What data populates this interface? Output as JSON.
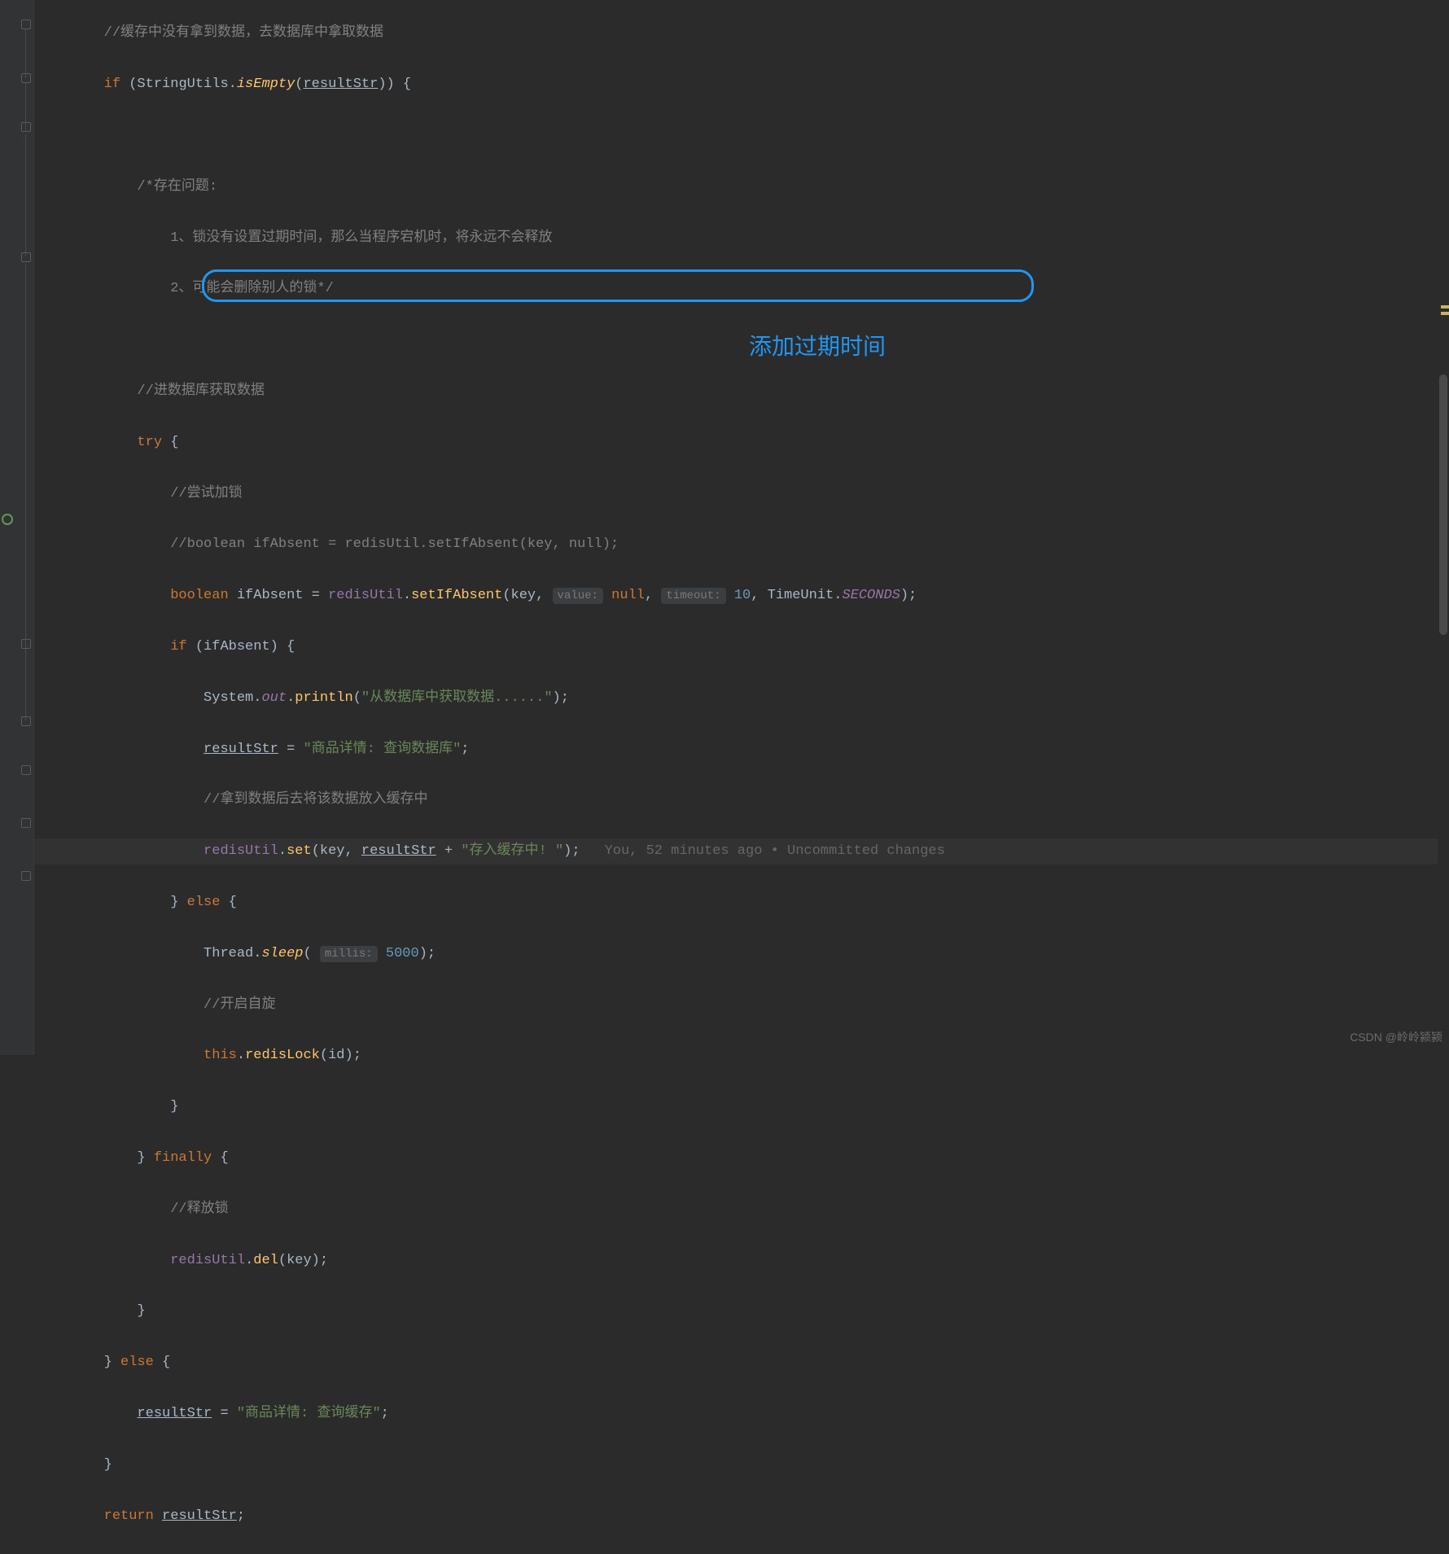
{
  "code": {
    "line1": "//缓存中没有拿到数据，去数据库中拿取数据",
    "line2_if": "if",
    "line2_a": " (StringUtils.",
    "line2_b": "isEmpty",
    "line2_c": "(",
    "line2_d": "resultStr",
    "line2_e": ")) {",
    "line3": "",
    "line4": "/*存在问题:",
    "line5": "    1、锁没有设置过期时间，那么当程序宕机时，将永远不会释放",
    "line6": "    2、可能会删除别人的锁*/",
    "line7": "",
    "line8": "//进数据库获取数据",
    "line9_try": "try",
    "line9_b": " {",
    "line10": "//尝试加锁",
    "line11": "//boolean ifAbsent = redisUtil.setIfAbsent(key, null);",
    "line12_a": "boolean",
    "line12_b": " ifAbsent = ",
    "line12_c": "redisUtil",
    "line12_d": ".",
    "line12_e": "setIfAbsent",
    "line12_f": "(key, ",
    "line12_hint1": "value:",
    "line12_g": " ",
    "line12_null": "null",
    "line12_h": ", ",
    "line12_hint2": "timeout:",
    "line12_i": " ",
    "line12_num": "10",
    "line12_j": ", TimeUnit.",
    "line12_const": "SECONDS",
    "line12_k": ");",
    "line13_if": "if",
    "line13_a": " (ifAbsent) {",
    "line14_a": "System.",
    "line14_out": "out",
    "line14_b": ".",
    "line14_c": "println",
    "line14_d": "(",
    "line14_str": "\"从数据库中获取数据......\"",
    "line14_e": ");",
    "line15_a": "resultStr",
    "line15_b": " = ",
    "line15_str": "\"商品详情: 查询数据库\"",
    "line15_c": ";",
    "line16": "//拿到数据后去将该数据放入缓存中",
    "line17_a": "redisUtil",
    "line17_b": ".",
    "line17_c": "set",
    "line17_d": "(key, ",
    "line17_e": "resultStr",
    "line17_f": " + ",
    "line17_str": "\"存入缓存中! \"",
    "line17_g": ");",
    "line17_blame": "You, 52 minutes ago • Uncommitted changes",
    "line18_a": "} ",
    "line18_else": "else",
    "line18_b": " {",
    "line19_a": "Thread.",
    "line19_b": "sleep",
    "line19_c": "( ",
    "line19_hint": "millis:",
    "line19_d": " ",
    "line19_num": "5000",
    "line19_e": ");",
    "line20": "//开启自旋",
    "line21_this": "this",
    "line21_a": ".",
    "line21_b": "redisLock",
    "line21_c": "(id);",
    "line22": "}",
    "line23_a": "} ",
    "line23_finally": "finally",
    "line23_b": " {",
    "line24": "//释放锁",
    "line25_a": "redisUtil",
    "line25_b": ".",
    "line25_c": "del",
    "line25_d": "(key);",
    "line26": "}",
    "line27_a": "} ",
    "line27_else": "else",
    "line27_b": " {",
    "line28_a": "resultStr",
    "line28_b": " = ",
    "line28_str": "\"商品详情: 查询缓存\"",
    "line28_c": ";",
    "line29": "}",
    "line30_return": "return",
    "line30_a": " ",
    "line30_b": "resultStr",
    "line30_c": ";"
  },
  "annotation": "添加过期时间",
  "watermark": "CSDN @岭岭颍颍",
  "indent": {
    "i1": "        ",
    "i2": "            ",
    "i3": "                ",
    "i4": "                    ",
    "i5": "                        "
  }
}
